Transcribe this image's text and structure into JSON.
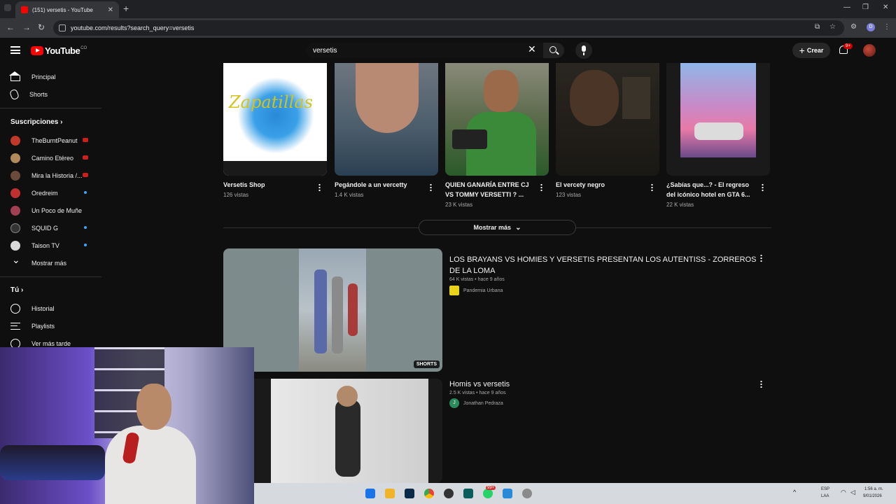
{
  "browser": {
    "tab_title": "(151) versetis - YouTube",
    "url": "youtube.com/results?search_query=versetis",
    "profile_initial": "D"
  },
  "header": {
    "logo_text": "YouTube",
    "country_code": "CO",
    "search_value": "versetis",
    "create_label": "Crear",
    "notification_count": "9+"
  },
  "sidebar": {
    "main_items": [
      {
        "label": "Principal",
        "icon": "home-icon"
      },
      {
        "label": "Shorts",
        "icon": "shorts-icon"
      }
    ],
    "subscriptions_heading": "Suscripciones",
    "subscriptions": [
      {
        "label": "TheBurntPeanut",
        "color": "#c0392b",
        "status": "live"
      },
      {
        "label": "Camino Etéreo",
        "color": "#b08a5a",
        "status": "live"
      },
      {
        "label": "Mira la Historia /...",
        "color": "#6b4a3a",
        "status": "live"
      },
      {
        "label": "Oredreim",
        "color": "#c03030",
        "status": "new"
      },
      {
        "label": "Un Poco de Muñe",
        "color": "#a04050",
        "status": "none"
      },
      {
        "label": "SQUID G",
        "color": "#333333",
        "status": "new"
      },
      {
        "label": "Taison TV",
        "color": "#d8d8d8",
        "status": "new"
      }
    ],
    "show_more": "Mostrar más",
    "you_heading": "Tú",
    "you_items": [
      {
        "label": "Historial",
        "icon": "history-icon"
      },
      {
        "label": "Playlists",
        "icon": "playlists-icon"
      },
      {
        "label": "Ver más tarde",
        "icon": "watch-later-icon"
      }
    ]
  },
  "shorts": [
    {
      "title": "Versetis Shop",
      "views": "126 vistas"
    },
    {
      "title": "Pegándole a un  vercetty",
      "views": "1.4 K vistas"
    },
    {
      "title": "QUIEN GANARÍA ENTRE CJ VS TOMMY VERSETTI ? ...",
      "views": "23 K vistas"
    },
    {
      "title": "El vercety negro",
      "views": "123 vistas"
    },
    {
      "title": "¿Sabías que...? - El regreso del icónico hotel en GTA 6...",
      "views": "22 K vistas"
    }
  ],
  "shorts_thumb_text": {
    "shop": "Zapatillas"
  },
  "more_button": "Mostrar más",
  "videos": [
    {
      "title": "LOS BRAYANS VS HOMIES Y VERSETIS PRESENTAN LOS AUTENTISS - ZORREROS DE LA LOMA",
      "meta": "64 K vistas • hace 9 años",
      "channel": "Pandemia Urbana",
      "badge": "SHORTS"
    },
    {
      "title": "Homis vs versetis",
      "meta": "2.5 K vistas • hace 9 años",
      "channel": "Jonathan Pedraza",
      "channel_initial": "J"
    }
  ],
  "taskbar": {
    "lang_line1": "ESP",
    "lang_line2": "LAA",
    "time": "1:56 a. m.",
    "date": "9/01/2026",
    "badge": "99+"
  },
  "colors": {
    "background": "#0f0f0f",
    "accent_red": "#ff0000",
    "text_secondary": "#aaaaaa"
  }
}
